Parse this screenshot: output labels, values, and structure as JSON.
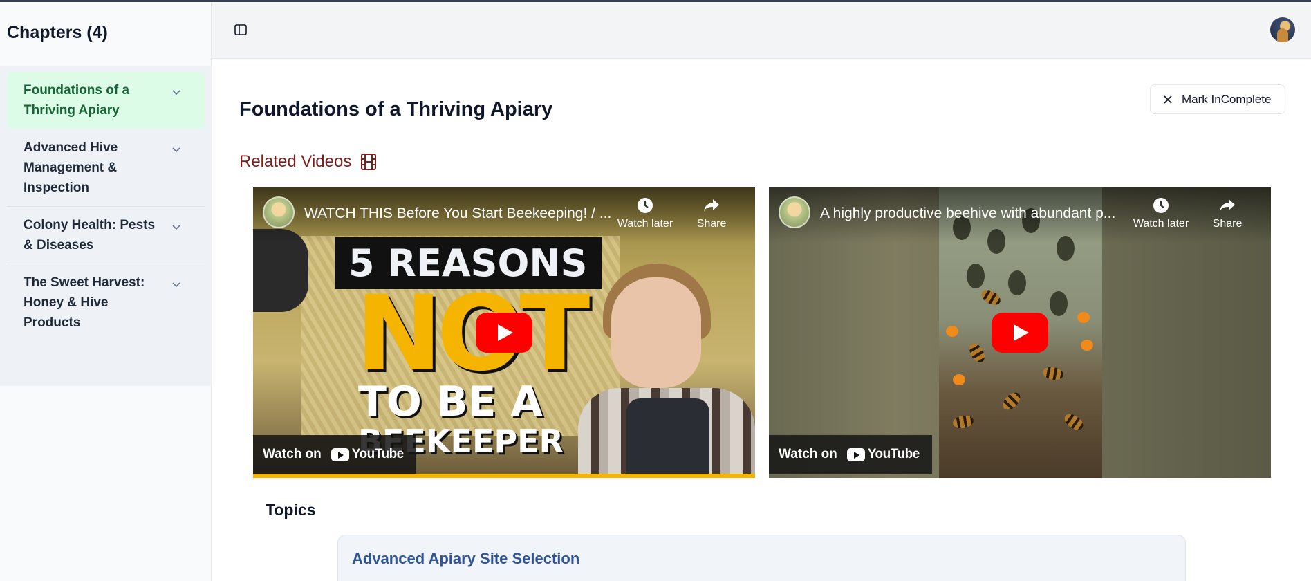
{
  "sidebar": {
    "title": "Chapters (4)",
    "chapters": [
      {
        "label": "Foundations of a Thriving Apiary",
        "active": true
      },
      {
        "label": "Advanced Hive Management & Inspection",
        "active": false
      },
      {
        "label": "Colony Health: Pests & Diseases",
        "active": false
      },
      {
        "label": "The Sweet Harvest: Honey & Hive Products",
        "active": false
      }
    ]
  },
  "header": {
    "toggle_icon": "sidebar-panel-icon",
    "avatar_icon": "user-avatar"
  },
  "main": {
    "title": "Foundations of a Thriving Apiary",
    "mark_button": "Mark InComplete",
    "related_videos_label": "Related Videos",
    "related_icon": "film-icon",
    "videos": [
      {
        "title": "WATCH THIS Before You Start Beekeeping! / ...",
        "watch_later": "Watch later",
        "share": "Share",
        "watch_on": "Watch on",
        "platform": "YouTube",
        "thumb_line1": "5 REASONS",
        "thumb_line2": "NOT",
        "thumb_line3": "TO BE A",
        "thumb_line4": "BEEKEEPER"
      },
      {
        "title": "A highly productive beehive with abundant p...",
        "watch_later": "Watch later",
        "share": "Share",
        "watch_on": "Watch on",
        "platform": "YouTube"
      }
    ],
    "topics_label": "Topics",
    "topics": [
      {
        "label": "Advanced Apiary Site Selection"
      }
    ]
  },
  "colors": {
    "active_chapter_bg": "#dcfce7",
    "active_chapter_text": "#166534",
    "related_label": "#7f1d1d",
    "topic_text": "#2f5597",
    "youtube_red": "#ff0000"
  }
}
